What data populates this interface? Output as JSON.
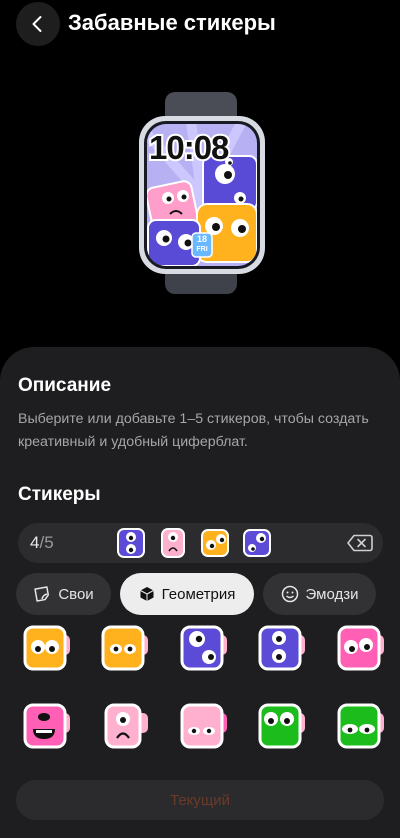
{
  "header": {
    "title": "Забавные стикеры"
  },
  "preview": {
    "time": "10:08",
    "date_day": "18",
    "date_weekday": "FRI"
  },
  "description": {
    "heading": "Описание",
    "text": "Выберите или добавьте 1–5 стикеров, чтобы создать креативный и удобный циферблат."
  },
  "stickers": {
    "heading": "Стикеры",
    "selected_count": "4",
    "selected_max": "5",
    "selected": [
      "purple",
      "pink",
      "orange",
      "purple-b"
    ]
  },
  "tabs": [
    {
      "label": "Свои",
      "icon": "sticker-icon",
      "active": false
    },
    {
      "label": "Геометрия",
      "icon": "cube-icon",
      "active": true
    },
    {
      "label": "Эмодзи",
      "icon": "smile-icon",
      "active": false
    }
  ],
  "grid_colors": {
    "orange": "#ffb21d",
    "purple": "#5b4bd6",
    "pink": "#ff5fb5",
    "light-pink": "#ffb0cf",
    "green": "#1dbc1d"
  },
  "grid": [
    [
      "orange",
      "orange",
      "purple",
      "purple",
      "pink"
    ],
    [
      "pink",
      "light-pink",
      "light-pink",
      "green",
      "green"
    ]
  ],
  "current_button": {
    "label": "Текущий"
  }
}
